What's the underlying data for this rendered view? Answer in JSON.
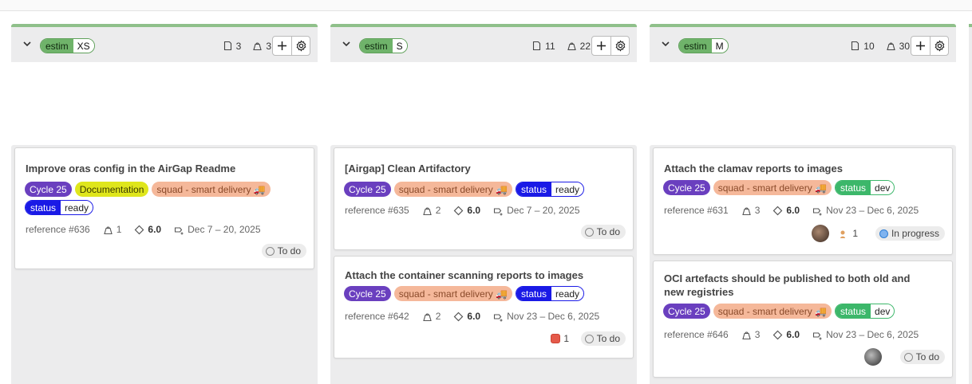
{
  "columns": [
    {
      "estim_key": "estim",
      "estim_value": "XS",
      "issue_count": "3",
      "weight_total": "3",
      "cards": [
        {
          "title": "Improve oras config in the AirGap Readme",
          "labels": [
            "Cycle 25",
            "Documentation",
            "squad - smart delivery 🚚"
          ],
          "scoped": {
            "key": "status",
            "value": "ready"
          },
          "reference": "reference #636",
          "weight": "1",
          "estimate": "6.0",
          "dates": "Dec 7 – 20, 2025",
          "status": "To do"
        }
      ]
    },
    {
      "estim_key": "estim",
      "estim_value": "S",
      "issue_count": "11",
      "weight_total": "22",
      "cards": [
        {
          "title": "[Airgap] Clean Artifactory",
          "labels": [
            "Cycle 25",
            "squad - smart delivery 🚚"
          ],
          "scoped": {
            "key": "status",
            "value": "ready"
          },
          "reference": "reference #635",
          "weight": "2",
          "estimate": "6.0",
          "dates": "Dec 7 – 20, 2025",
          "status": "To do"
        },
        {
          "title": "Attach the container scanning reports to images",
          "labels": [
            "Cycle 25",
            "squad - smart delivery 🚚"
          ],
          "scoped": {
            "key": "status",
            "value": "ready"
          },
          "reference": "reference #642",
          "weight": "2",
          "estimate": "6.0",
          "dates": "Nov 23 – Dec 6, 2025",
          "badge_count": "1",
          "status": "To do"
        }
      ]
    },
    {
      "estim_key": "estim",
      "estim_value": "M",
      "issue_count": "10",
      "weight_total": "30",
      "cards": [
        {
          "title": "Attach the clamav reports to images",
          "labels": [
            "Cycle 25",
            "squad - smart delivery 🚚"
          ],
          "scoped": {
            "key": "status",
            "value": "dev"
          },
          "reference": "reference #631",
          "weight": "3",
          "estimate": "6.0",
          "dates": "Nov 23 – Dec 6, 2025",
          "participants": "1",
          "status": "In progress"
        },
        {
          "title": "OCI artefacts should be published to both old and new registries",
          "labels": [
            "Cycle 25",
            "squad - smart delivery 🚚"
          ],
          "scoped": {
            "key": "status",
            "value": "dev"
          },
          "reference": "reference #646",
          "weight": "3",
          "estimate": "6.0",
          "dates": "Nov 23 – Dec 6, 2025",
          "status": "To do"
        }
      ]
    }
  ],
  "colors": {
    "accent_border": "#8fc08a",
    "cycle": "#6a3fbf",
    "status_blue": "#1a1ae6",
    "status_green": "#3cb76a",
    "squad": "#f5b89a",
    "doc": "#dfe61c"
  },
  "icons": [
    "chevron-down-icon",
    "issue-icon",
    "weight-icon",
    "plus-icon",
    "gear-icon",
    "estimate-icon",
    "milestone-icon",
    "status-icon"
  ]
}
